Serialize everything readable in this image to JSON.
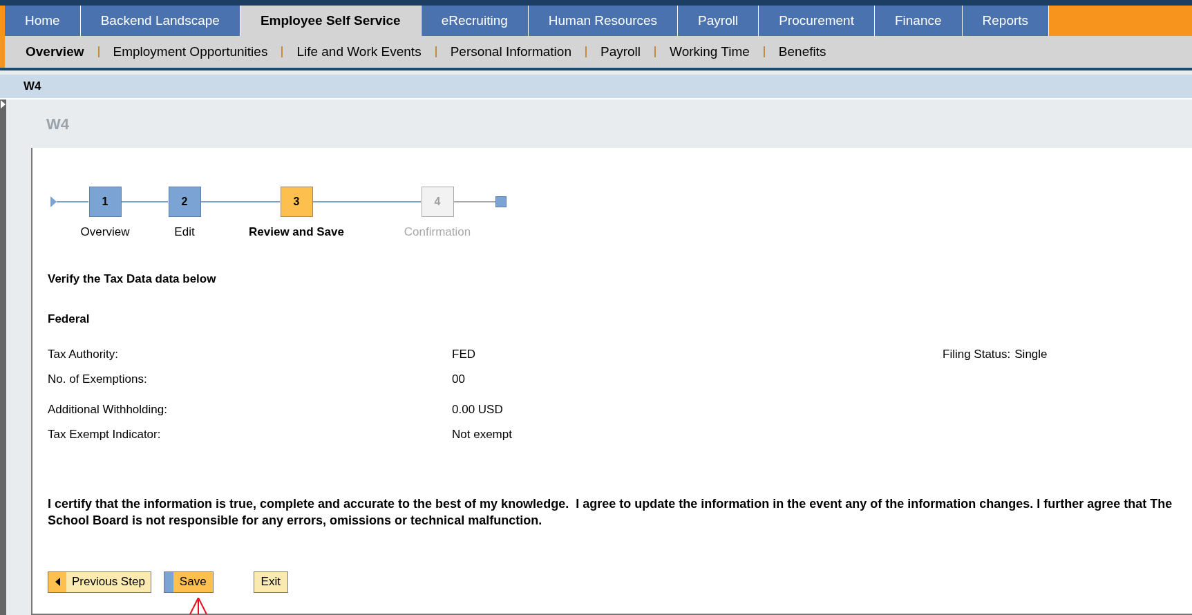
{
  "top_tabs": [
    {
      "label": "Home",
      "selected": false
    },
    {
      "label": "Backend Landscape",
      "selected": false
    },
    {
      "label": "Employee Self Service",
      "selected": true
    },
    {
      "label": "eRecruiting",
      "selected": false
    },
    {
      "label": "Human Resources",
      "selected": false
    },
    {
      "label": "Payroll",
      "selected": false
    },
    {
      "label": "Procurement",
      "selected": false
    },
    {
      "label": "Finance",
      "selected": false
    },
    {
      "label": "Reports",
      "selected": false
    }
  ],
  "sub_nav": [
    {
      "label": "Overview",
      "selected": true
    },
    {
      "label": "Employment Opportunities",
      "selected": false
    },
    {
      "label": "Life and Work Events",
      "selected": false
    },
    {
      "label": "Personal Information",
      "selected": false
    },
    {
      "label": "Payroll",
      "selected": false
    },
    {
      "label": "Working Time",
      "selected": false
    },
    {
      "label": "Benefits",
      "selected": false
    }
  ],
  "page_title": "W4",
  "panel_title": "W4",
  "steps": [
    {
      "number": "1",
      "label": "Overview",
      "kind": "done"
    },
    {
      "number": "2",
      "label": "Edit",
      "kind": "done"
    },
    {
      "number": "3",
      "label": "Review and Save",
      "kind": "current"
    },
    {
      "number": "4",
      "label": "Confirmation",
      "kind": "pending"
    }
  ],
  "instruction": "Verify the Tax Data data below",
  "section_title": "Federal",
  "fields": [
    {
      "label": "Tax Authority:",
      "value": "FED",
      "extra_label": "Filing Status:",
      "extra_value": "Single"
    },
    {
      "label": "No. of Exemptions:",
      "value": "00"
    },
    {
      "label": "Additional Withholding:",
      "value": "0.00 USD"
    },
    {
      "label": "Tax Exempt Indicator:",
      "value": "Not exempt"
    }
  ],
  "certification": "I certify that the information is true, complete and accurate to the best of my knowledge.  I agree to update the information in the event any of the information changes. I further agree that The School Board is not responsible for any errors, omissions or technical malfunction.",
  "buttons": [
    {
      "label": "Previous Step",
      "kind": "previous"
    },
    {
      "label": "Save",
      "kind": "primary"
    },
    {
      "label": "Exit",
      "kind": "plain"
    }
  ]
}
